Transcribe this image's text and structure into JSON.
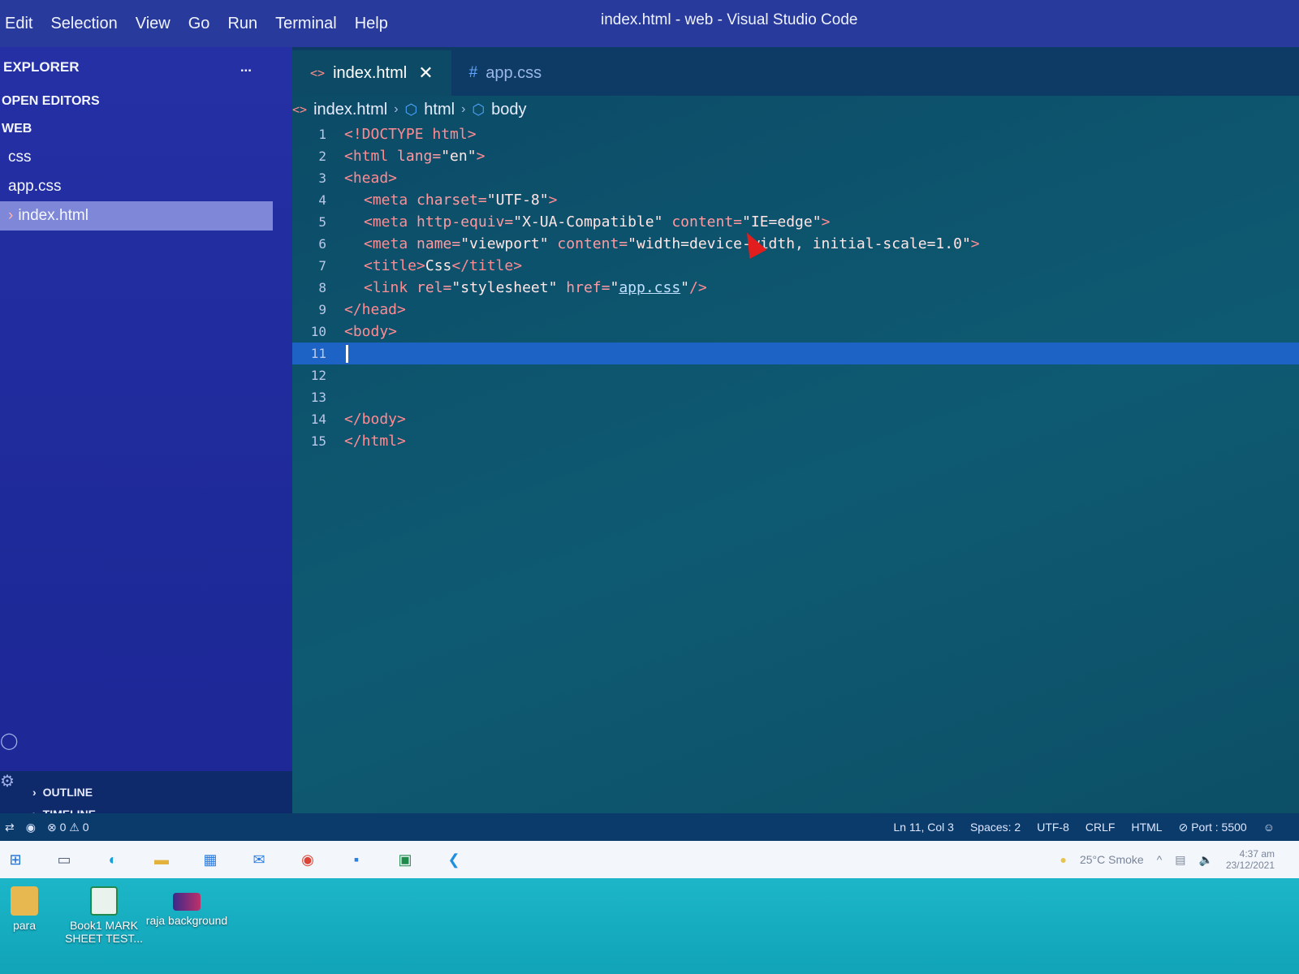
{
  "window": {
    "title": "index.html - web - Visual Studio Code",
    "menu": [
      "Edit",
      "Selection",
      "View",
      "Go",
      "Run",
      "Terminal",
      "Help"
    ]
  },
  "sidebar": {
    "header": "EXPLORER",
    "more": "...",
    "open_editors": "OPEN EDITORS",
    "folder": "WEB",
    "items": [
      "css",
      "app.css",
      "index.html"
    ],
    "outline": "OUTLINE",
    "timeline": "TIMELINE"
  },
  "tabs": [
    {
      "label": "index.html",
      "icon": "html-file-icon",
      "active": true
    },
    {
      "label": "app.css",
      "icon": "css-file-icon",
      "active": false
    }
  ],
  "breadcrumb": [
    "index.html",
    "html",
    "body"
  ],
  "code": {
    "line_numbers": [
      "1",
      "2",
      "3",
      "4",
      "5",
      "6",
      "7",
      "8",
      "9",
      "10",
      "11",
      "12",
      "13",
      "14",
      "15"
    ],
    "l1": "<!DOCTYPE html>",
    "l2a": "<html ",
    "l2b": "lang=",
    "l2c": "\"en\"",
    "l2d": ">",
    "l3": "<head>",
    "l4a": "<meta ",
    "l4b": "charset=",
    "l4c": "\"UTF-8\"",
    "l4d": ">",
    "l5a": "<meta ",
    "l5b": "http-equiv=",
    "l5c": "\"X-UA-Compatible\"",
    "l5d": " content=",
    "l5e": "\"IE=edge\"",
    "l5f": ">",
    "l6a": "<meta ",
    "l6b": "name=",
    "l6c": "\"viewport\"",
    "l6d": " content=",
    "l6e": "\"width=device-width, initial-scale=1.0\"",
    "l6f": ">",
    "l7a": "<title>",
    "l7b": "Css",
    "l7c": "</title>",
    "l8a": "<link ",
    "l8b": "rel=",
    "l8c": "\"stylesheet\"",
    "l8d": " href=",
    "l8e": "\"",
    "l8f": "app.css",
    "l8g": "\"",
    "l8h": "/>",
    "l9": "</head>",
    "l10": "<body>",
    "l14": "</body>",
    "l15": "</html>"
  },
  "status": {
    "errors": "0",
    "warnings": "0",
    "position": "Ln 11, Col 3",
    "spaces": "Spaces: 2",
    "encoding": "UTF-8",
    "eol": "CRLF",
    "language": "HTML",
    "port": "Port : 5500"
  },
  "taskbar": {
    "weather": "25°C  Smoke",
    "time": "4:37 am",
    "date": "23/12/2021"
  },
  "desktop": [
    {
      "label": "para",
      "icon": "folder-icon"
    },
    {
      "label": "Book1 MARK SHEET TEST...",
      "icon": "excel-file-icon"
    },
    {
      "label": "raja background",
      "icon": "image-file-icon"
    }
  ],
  "colors": {
    "sidebar": "#2430a4",
    "editor": "#0c4a66",
    "tag": "#ff8b92",
    "current_line": "#1d63c6",
    "desktop": "#1cb6c8"
  }
}
